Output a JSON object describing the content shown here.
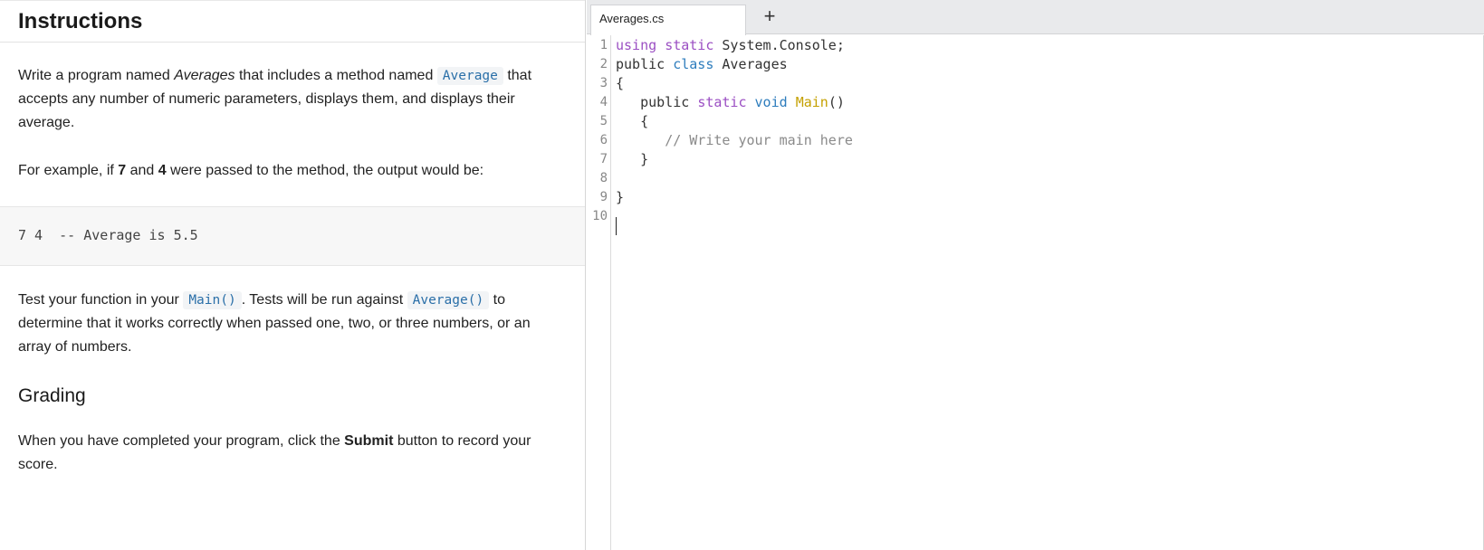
{
  "instructions": {
    "title": "Instructions",
    "p1": {
      "a": "Write a program named ",
      "b": "Averages",
      "c": " that includes a method named ",
      "code": "Average",
      "d": " that accepts any number of numeric parameters, displays them, and displays their average."
    },
    "p2": {
      "a": "For example, if ",
      "b": "7",
      "c": " and ",
      "d": "4",
      "e": " were passed to the method, the output would be:"
    },
    "example_output": "7 4  -- Average is 5.5",
    "p3": {
      "a": "Test your function in your ",
      "code1": "Main()",
      "b": ". Tests will be run against ",
      "code2": "Average()",
      "c": " to determine that it works correctly when passed one, two, or three numbers, or an array of numbers."
    },
    "grading_title": "Grading",
    "p4": {
      "a": "When you have completed your program, click the ",
      "b": "Submit",
      "c": " button to record your score."
    }
  },
  "editor": {
    "tab_label": "Averages.cs",
    "add_tab_label": "+",
    "line_numbers": [
      "1",
      "2",
      "3",
      "4",
      "5",
      "6",
      "7",
      "8",
      "9",
      "10"
    ],
    "lines": [
      [
        {
          "t": "using",
          "c": "#9b4fc3"
        },
        {
          "t": " "
        },
        {
          "t": "static",
          "c": "#9b4fc3"
        },
        {
          "t": " System.Console;"
        }
      ],
      [
        {
          "t": "public "
        },
        {
          "t": "class",
          "c": "#2e7dbd"
        },
        {
          "t": " Averages"
        }
      ],
      [
        {
          "t": "{"
        }
      ],
      [
        {
          "t": "   public "
        },
        {
          "t": "static",
          "c": "#9b4fc3"
        },
        {
          "t": " "
        },
        {
          "t": "void",
          "c": "#2e7dbd"
        },
        {
          "t": " "
        },
        {
          "t": "Main",
          "c": "#c4a000"
        },
        {
          "t": "()"
        }
      ],
      [
        {
          "t": "   {"
        }
      ],
      [
        {
          "t": "      "
        },
        {
          "t": "// Write your main here",
          "c": "#8a8a8a"
        }
      ],
      [
        {
          "t": "   }"
        }
      ],
      [
        {
          "t": ""
        }
      ],
      [
        {
          "t": "}"
        }
      ],
      [
        {
          "t": ""
        }
      ]
    ]
  }
}
